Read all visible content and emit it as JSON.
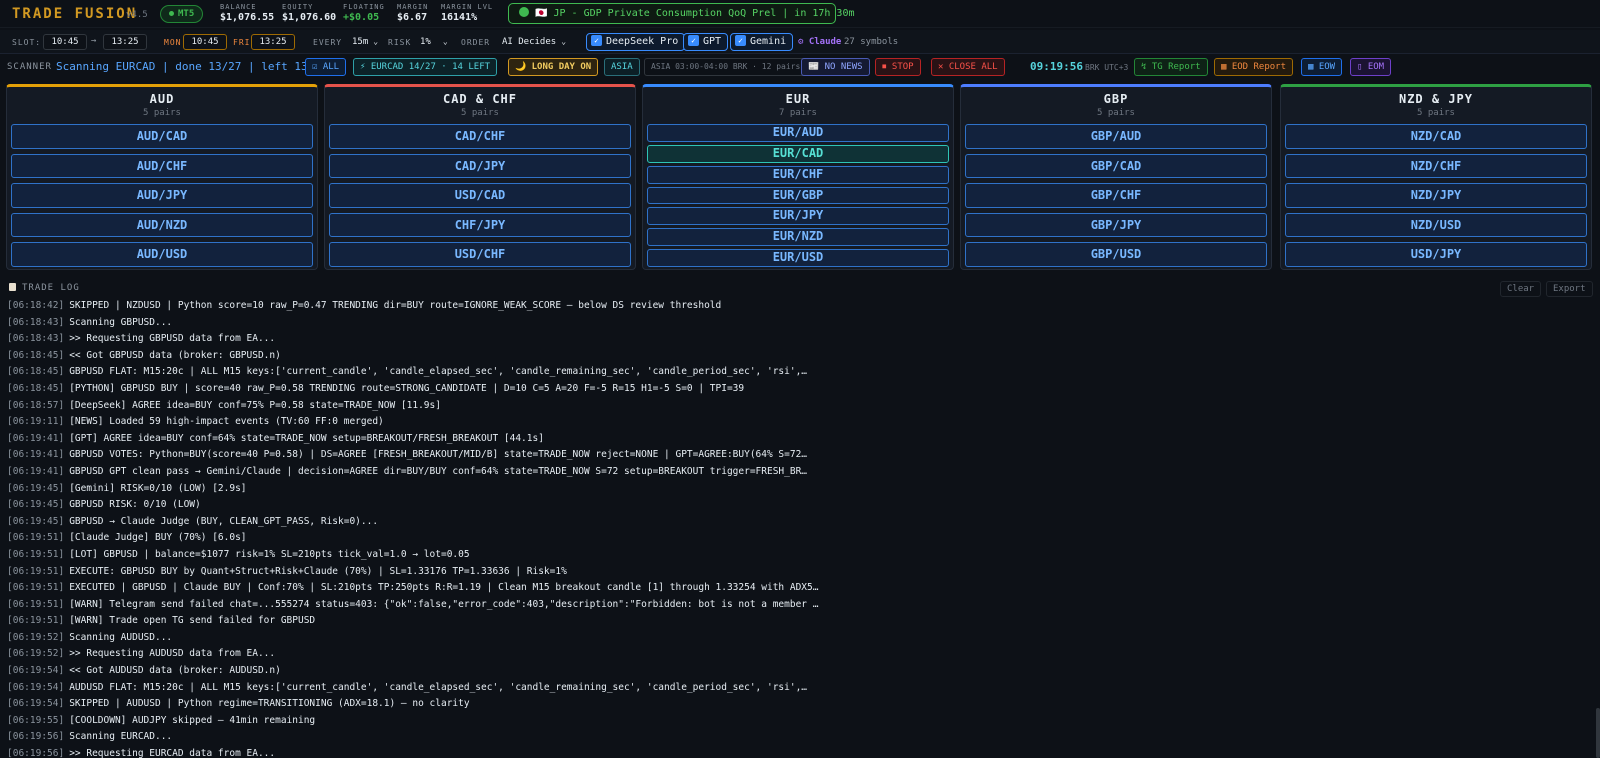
{
  "header": {
    "title": "TRADE FUSION",
    "version": "v4.5",
    "platform": "MT5",
    "stats": [
      {
        "label": "BALANCE",
        "value": "$1,076.55"
      },
      {
        "label": "EQUITY",
        "value": "$1,076.60"
      },
      {
        "label": "FLOATING",
        "value": "+$0.05"
      },
      {
        "label": "MARGIN",
        "value": "$6.67"
      },
      {
        "label": "MARGIN LVL",
        "value": "16141%"
      }
    ],
    "news_banner": "🇯🇵 JP - GDP Private Consumption QoQ Prel | in 17h 30m"
  },
  "settings": {
    "slot_label": "SLOT:",
    "slot_start": "10:45",
    "slot_arrow": "→",
    "slot_end": "13:25",
    "mon_label": "MON",
    "mon_time": "10:45",
    "fri_label": "FRI",
    "fri_time": "13:25",
    "every_label": "EVERY",
    "every_value": "15m",
    "risk_label": "RISK",
    "risk_value": "1%",
    "order_label": "ORDER",
    "order_value": "AI Decides",
    "ai_models": [
      "DeepSeek Pro",
      "GPT",
      "Gemini"
    ],
    "claude_label": "Claude",
    "symbols_count": "27 symbols",
    "accent": "#388bfd"
  },
  "scanner": {
    "label": "SCANNER",
    "status": "Scanning EURCAD | done 13/27 | left 13",
    "chips": {
      "all": "☑ ALL",
      "progress": "⚡ EURCAD 14/27 · 14 LEFT",
      "long_day": "🌙 LONG DAY ON",
      "session": "ASIA",
      "session_info": "ASIA 03:00-04:00 BRK · 12 pairs",
      "no_news": "📰 NO NEWS",
      "stop": "⏹ STOP",
      "close_all": "✕ CLOSE ALL",
      "tg_report": "↯ TG Report",
      "eod_report": "▦ EOD Report",
      "eow": "▦ EOW",
      "eom": "▯ EOM"
    },
    "clock": "09:19:56",
    "broker_tz": "BRK UTC+3"
  },
  "groups": [
    {
      "title": "AUD",
      "subtitle": "5 pairs",
      "color": "#e3a008",
      "pairs": [
        "AUD/CAD",
        "AUD/CHF",
        "AUD/JPY",
        "AUD/NZD",
        "AUD/USD"
      ]
    },
    {
      "title": "CAD & CHF",
      "subtitle": "5 pairs",
      "color": "#e5534b",
      "pairs": [
        "CAD/CHF",
        "CAD/JPY",
        "USD/CAD",
        "CHF/JPY",
        "USD/CHF"
      ]
    },
    {
      "title": "EUR",
      "subtitle": "7 pairs",
      "color": "#388bfd",
      "pairs": [
        "EUR/AUD",
        "EUR/CAD",
        "EUR/CHF",
        "EUR/GBP",
        "EUR/JPY",
        "EUR/NZD",
        "EUR/USD"
      ],
      "active_pair": "EUR/CAD"
    },
    {
      "title": "GBP",
      "subtitle": "5 pairs",
      "color": "#4d7dff",
      "pairs": [
        "GBP/AUD",
        "GBP/CAD",
        "GBP/CHF",
        "GBP/JPY",
        "GBP/USD"
      ]
    },
    {
      "title": "NZD & JPY",
      "subtitle": "5 pairs",
      "color": "#2ea043",
      "pairs": [
        "NZD/CAD",
        "NZD/CHF",
        "NZD/JPY",
        "NZD/USD",
        "USD/JPY"
      ]
    }
  ],
  "trade_log": {
    "title": "TRADE LOG",
    "clear_label": "Clear",
    "export_label": "Export",
    "lines": [
      {
        "ts": "[06:18:42]",
        "text": "SKIPPED | NZDUSD | Python score=10 raw_P=0.47 TRENDING dir=BUY route=IGNORE_WEAK_SCORE — below DS review threshold"
      },
      {
        "ts": "[06:18:43]",
        "text": "Scanning GBPUSD..."
      },
      {
        "ts": "[06:18:43]",
        "text": ">> Requesting GBPUSD data from EA..."
      },
      {
        "ts": "[06:18:45]",
        "text": "<< Got GBPUSD data (broker: GBPUSD.n)"
      },
      {
        "ts": "[06:18:45]",
        "text": "GBPUSD FLAT: M15:20c | ALL M15 keys:['current_candle', 'candle_elapsed_sec', 'candle_remaining_sec', 'candle_period_sec', 'rsi',…"
      },
      {
        "ts": "[06:18:45]",
        "text": "[PYTHON] GBPUSD BUY | score=40 raw_P=0.58 TRENDING route=STRONG_CANDIDATE | D=10 C=5 A=20 F=-5 R=15 H1=-5 S=0 | TPI=39"
      },
      {
        "ts": "[06:18:57]",
        "text": "[DeepSeek] AGREE idea=BUY conf=75% P=0.58 state=TRADE_NOW [11.9s]"
      },
      {
        "ts": "[06:19:11]",
        "text": "[NEWS] Loaded 59 high-impact events (TV:60 FF:0 merged)"
      },
      {
        "ts": "[06:19:41]",
        "text": "[GPT] AGREE idea=BUY conf=64% state=TRADE_NOW setup=BREAKOUT/FRESH_BREAKOUT [44.1s]"
      },
      {
        "ts": "[06:19:41]",
        "text": "GBPUSD VOTES: Python=BUY(score=40 P=0.58) | DS=AGREE [FRESH_BREAKOUT/MID/B] state=TRADE_NOW reject=NONE | GPT=AGREE:BUY(64% S=72…"
      },
      {
        "ts": "[06:19:41]",
        "text": "GBPUSD GPT clean pass → Gemini/Claude | decision=AGREE dir=BUY/BUY conf=64% state=TRADE_NOW S=72 setup=BREAKOUT trigger=FRESH_BR…"
      },
      {
        "ts": "[06:19:45]",
        "text": "[Gemini] RISK=0/10 (LOW) [2.9s]"
      },
      {
        "ts": "[06:19:45]",
        "text": "GBPUSD RISK: 0/10 (LOW)"
      },
      {
        "ts": "[06:19:45]",
        "text": "GBPUSD → Claude Judge (BUY, CLEAN_GPT_PASS, Risk=0)..."
      },
      {
        "ts": "[06:19:51]",
        "text": "[Claude Judge] BUY (70%) [6.0s]"
      },
      {
        "ts": "[06:19:51]",
        "text": "[LOT] GBPUSD | balance=$1077 risk=1% SL=210pts tick_val=1.0 → lot=0.05"
      },
      {
        "ts": "[06:19:51]",
        "text": "EXECUTE: GBPUSD BUY by Quant+Struct+Risk+Claude (70%) | SL=1.33176 TP=1.33636 | Risk=1%"
      },
      {
        "ts": "[06:19:51]",
        "text": "EXECUTED | GBPUSD | Claude BUY | Conf:70% | SL:210pts TP:250pts R:R=1.19 | Clean M15 breakout candle [1] through 1.33254 with ADX5…"
      },
      {
        "ts": "[06:19:51]",
        "text": "[WARN] Telegram send failed chat=...555274 status=403: {\"ok\":false,\"error_code\":403,\"description\":\"Forbidden: bot is not a member …"
      },
      {
        "ts": "[06:19:51]",
        "text": "[WARN] Trade open TG send failed for GBPUSD"
      },
      {
        "ts": "[06:19:52]",
        "text": "Scanning AUDUSD..."
      },
      {
        "ts": "[06:19:52]",
        "text": ">> Requesting AUDUSD data from EA..."
      },
      {
        "ts": "[06:19:54]",
        "text": "<< Got AUDUSD data (broker: AUDUSD.n)"
      },
      {
        "ts": "[06:19:54]",
        "text": "AUDUSD FLAT: M15:20c | ALL M15 keys:['current_candle', 'candle_elapsed_sec', 'candle_remaining_sec', 'candle_period_sec', 'rsi',…"
      },
      {
        "ts": "[06:19:54]",
        "text": "SKIPPED | AUDUSD | Python regime=TRANSITIONING (ADX=18.1) — no clarity"
      },
      {
        "ts": "[06:19:55]",
        "text": "[COOLDOWN] AUDJPY skipped — 41min remaining"
      },
      {
        "ts": "[06:19:56]",
        "text": "Scanning EURCAD..."
      },
      {
        "ts": "[06:19:56]",
        "text": ">> Requesting EURCAD data from EA..."
      }
    ]
  }
}
